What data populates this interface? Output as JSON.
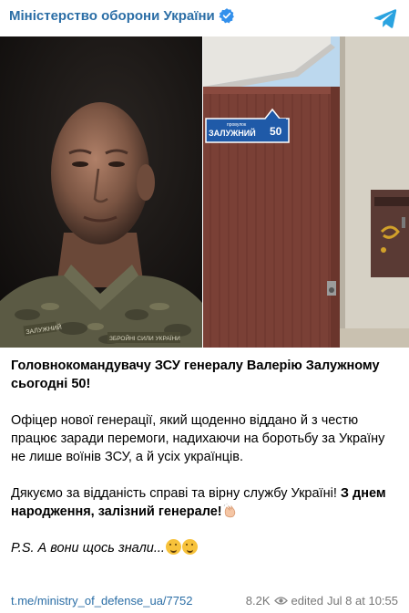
{
  "channel": {
    "name": "Міністерство оборони України"
  },
  "colors": {
    "link": "#2b6ea6",
    "verified": "#3390ec",
    "telegram": "#2aa3e0"
  },
  "images": {
    "left": {
      "patch_text": "ЗАЛУЖНИЙ",
      "badge_text": "ЗБРОЙНІ СИЛИ УКРАЇНИ"
    },
    "right": {
      "sign_top": "провулок",
      "sign_street": "ЗАЛУЖНИЙ",
      "sign_number": "50"
    }
  },
  "post": {
    "headline": "Головнокомандувачу ЗСУ генералу Валерію Залужному сьогодні 50!",
    "paragraph1": "Офіцер нової генерації, який щоденно віддано й з честю працює заради перемоги, надихаючи на боротьбу за Україну не лише воїнів ЗСУ, а й усіх українців.",
    "paragraph2_regular": "Дякуємо за відданість справі та вірну службу Україні! ",
    "paragraph2_bold": "З днем народження, залізний генерале!",
    "ps": "P.S. А вони щось знали..."
  },
  "footer": {
    "link": "t.me/ministry_of_defense_ua/7752",
    "views": "8.2K",
    "edited": "edited",
    "date": "Jul 8 at 10:55"
  }
}
